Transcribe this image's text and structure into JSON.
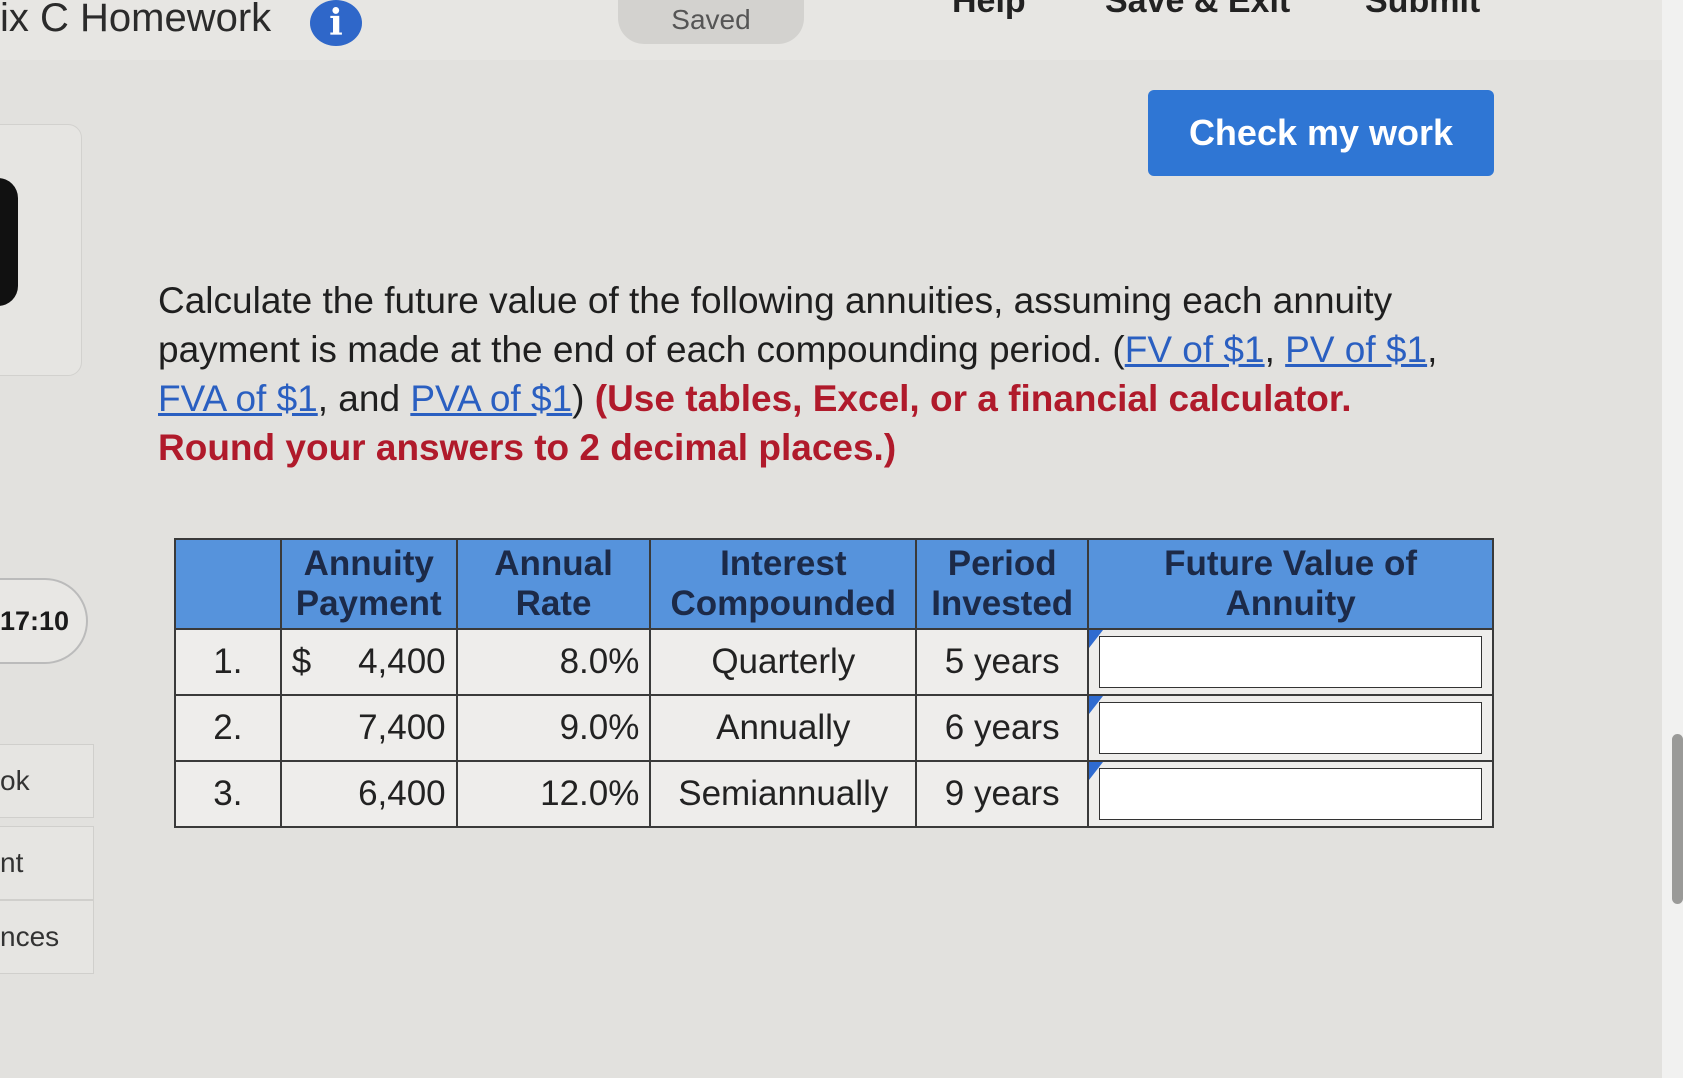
{
  "header": {
    "title": "ix C Homework",
    "saved": "Saved",
    "help": "Help",
    "save_exit": "Save & Exit",
    "submit": "Submit"
  },
  "sidebar": {
    "timer": "17:10",
    "items": [
      "ok",
      "nt",
      "nces"
    ]
  },
  "check_button": "Check my work",
  "question": {
    "text": "Calculate the future value of the following annuities, assuming each annuity payment is made at the end of each compounding period.",
    "links": [
      "FV of $1",
      "PV of $1",
      "FVA of $1",
      "PVA of $1"
    ],
    "instruction": "(Use tables, Excel, or a financial calculator. Round your answers to 2 decimal places.)"
  },
  "table": {
    "headers": [
      "",
      "Annuity Payment",
      "Annual Rate",
      "Interest Compounded",
      "Period Invested",
      "Future Value of Annuity"
    ],
    "rows": [
      {
        "num": "1.",
        "currency": "$",
        "payment": "4,400",
        "rate": "8.0%",
        "compounded": "Quarterly",
        "period": "5 years",
        "fv": ""
      },
      {
        "num": "2.",
        "currency": "",
        "payment": "7,400",
        "rate": "9.0%",
        "compounded": "Annually",
        "period": "6 years",
        "fv": ""
      },
      {
        "num": "3.",
        "currency": "",
        "payment": "6,400",
        "rate": "12.0%",
        "compounded": "Semiannually",
        "period": "9 years",
        "fv": ""
      }
    ]
  },
  "colors": {
    "accent": "#2f76d4",
    "header_fill": "#5693dc",
    "instruction": "#b01a2b"
  }
}
